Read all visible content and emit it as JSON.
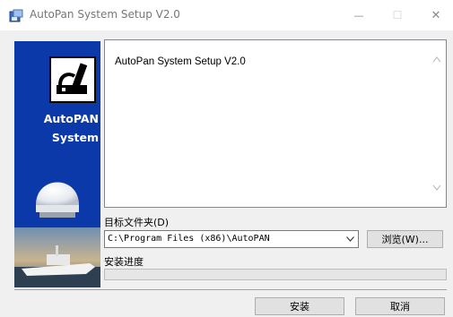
{
  "window": {
    "title": "AutoPan System Setup V2.0",
    "minimize_glyph": "—",
    "maximize_glyph": "☐",
    "close_glyph": "✕",
    "icon": "installer-icon"
  },
  "sidebar": {
    "brand_line1": "AutoPAN",
    "brand_line2": "System",
    "icons": [
      "usb-drive-icon",
      "satellite-radome-icon",
      "ship-photo"
    ]
  },
  "log": {
    "lines": [
      "AutoPan System Setup V2.0"
    ]
  },
  "install_folder": {
    "label": "目标文件夹(D)",
    "value": "C:\\Program Files (x86)\\AutoPAN",
    "browse_label": "浏览(W)..."
  },
  "progress": {
    "label": "安装进度",
    "fraction": 0.0
  },
  "buttons": {
    "install": "安装",
    "cancel": "取消"
  },
  "colors": {
    "sidebar_blue": "#0b39a9",
    "progress_green": "#06b025"
  }
}
